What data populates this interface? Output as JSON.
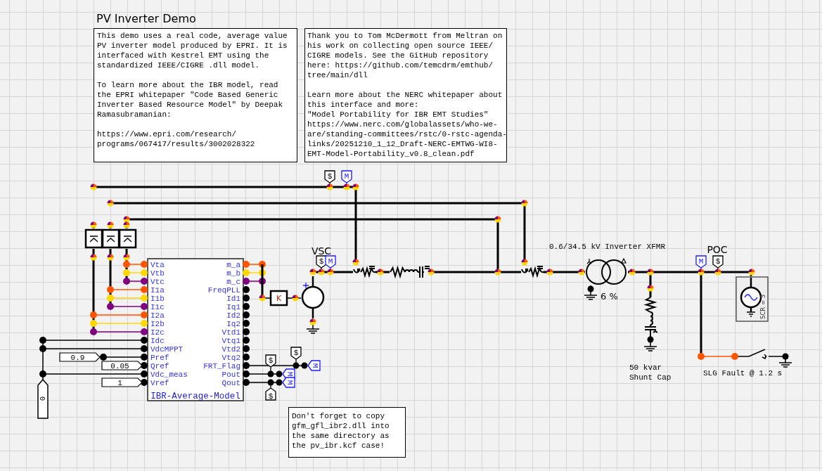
{
  "title": "PV Inverter Demo",
  "notes": [
    {
      "text": "This demo uses a real code, average value\nPV inverter model produced by EPRI. It is\ninterfaced with Kestrel EMT using the\nstandardized IEEE/CIGRE .dll model.\n\nTo learn more about the IBR model, read\nthe EPRI whitepaper \"Code Based Generic\nInverter Based Resource Model\" by Deepak\nRamasubramanian:\n\nhttps://www.epri.com/research/\nprograms/067417/results/3002028322"
    },
    {
      "text": "Thank you to Tom McDermott from Meltran on\nhis work on collecting open source IEEE/\nCIGRE models. See the GitHub repository\nhere: https://github.com/temcdrm/emthub/\ntree/main/dll\n\nLearn more about the NERC whitepaper about\nthis interface and more:\n\"Model Portability for IBR EMT Studies\"\nhttps://www.nerc.com/globalassets/who-we-\nare/standing-committees/rstc/0-rstc-agenda-\nlinks/20251210_1_12_Draft-NERC-EMTWG-WI8-\nEMT-Model-Portability_v0.8_clean.pdf"
    },
    {
      "text": "Don't forget to copy\ngfm_gfl_ibr2.dll into\nthe same directory as\nthe pv_ibr.kcf case!"
    }
  ],
  "ibr_block": {
    "title": "IBR-Average-Model",
    "inputs": [
      {
        "label": "Vta",
        "color": "#ff5500"
      },
      {
        "label": "Vtb",
        "color": "#ffd700"
      },
      {
        "label": "Vtc",
        "color": "#800080"
      },
      {
        "label": "I1a",
        "color": "#ff5500"
      },
      {
        "label": "I1b",
        "color": "#ffd700"
      },
      {
        "label": "I1c",
        "color": "#800080"
      },
      {
        "label": "I2a",
        "color": "#ff5500"
      },
      {
        "label": "I2b",
        "color": "#ffd700"
      },
      {
        "label": "I2c",
        "color": "#800080"
      },
      {
        "label": "Idc",
        "color": "#000000"
      },
      {
        "label": "VdcMPPT",
        "color": "#000000"
      },
      {
        "label": "Pref",
        "color": "#000000"
      },
      {
        "label": "Qref",
        "color": "#000000"
      },
      {
        "label": "Vdc_meas",
        "color": "#000000"
      },
      {
        "label": "Vref",
        "color": "#000000"
      }
    ],
    "outputs": [
      {
        "label": "m_a",
        "color": "#ff5500"
      },
      {
        "label": "m_b",
        "color": "#ffd700"
      },
      {
        "label": "m_c",
        "color": "#800080"
      },
      {
        "label": "FreqPLL",
        "color": "#000000"
      },
      {
        "label": "Id1",
        "color": "#000000"
      },
      {
        "label": "Iq1",
        "color": "#000000"
      },
      {
        "label": "Id2",
        "color": "#000000"
      },
      {
        "label": "Iq2",
        "color": "#000000"
      },
      {
        "label": "Vtd1",
        "color": "#000000"
      },
      {
        "label": "Vtq1",
        "color": "#000000"
      },
      {
        "label": "Vtd2",
        "color": "#000000"
      },
      {
        "label": "Vtq2",
        "color": "#000000"
      },
      {
        "label": "FRT_Flag",
        "color": "#000000"
      },
      {
        "label": "Pout",
        "color": "#000000"
      },
      {
        "label": "Qout",
        "color": "#000000"
      }
    ]
  },
  "constants": [
    "0.9",
    "0.05",
    "1"
  ],
  "dc_source": {
    "label": "0"
  },
  "gain": {
    "label": "K"
  },
  "vsc": {
    "label": "VSC"
  },
  "transformer": {
    "label": "0.6/34.5 kV Inverter XFMR",
    "impedance": "6 %"
  },
  "shunt_cap": {
    "label": "50 kvar\nShunt Cap"
  },
  "poc": {
    "label": "POC"
  },
  "fault": {
    "label": "SLG Fault @ 1.2 s"
  },
  "grid_source": {
    "label": "SCR = 3"
  },
  "tags": [
    {
      "kind": "probe",
      "text": "$"
    },
    {
      "kind": "meter",
      "text": "M"
    },
    {
      "kind": "probe",
      "text": "$"
    },
    {
      "kind": "meter",
      "text": "M"
    },
    {
      "kind": "meter",
      "text": "M"
    },
    {
      "kind": "probe",
      "text": "$"
    },
    {
      "kind": "probe",
      "text": "$"
    },
    {
      "kind": "meter",
      "text": "M"
    },
    {
      "kind": "probe",
      "text": "$"
    },
    {
      "kind": "meter",
      "text": "M"
    },
    {
      "kind": "meter",
      "text": "M"
    },
    {
      "kind": "probe",
      "text": "$"
    }
  ]
}
